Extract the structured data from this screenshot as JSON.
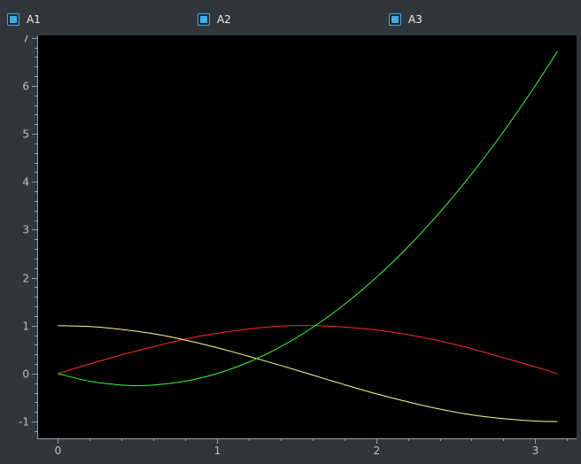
{
  "legend": {
    "items": [
      {
        "label": "A1",
        "checked": true
      },
      {
        "label": "A2",
        "checked": true
      },
      {
        "label": "A3",
        "checked": true
      }
    ]
  },
  "colors": {
    "accent": "#3daee9",
    "plot_background": "#000000",
    "axis": "#9ba0a5",
    "tick_label": "#bcc1c5"
  },
  "chart_data": {
    "type": "line",
    "title": "",
    "xlabel": "",
    "ylabel": "",
    "xlim": [
      -0.13,
      3.26
    ],
    "ylim": [
      -1.35,
      7.05
    ],
    "x_ticks": [
      0,
      1,
      2,
      3
    ],
    "y_ticks": [
      -1,
      0,
      1,
      2,
      3,
      4,
      5,
      6,
      7
    ],
    "grid": false,
    "series": [
      {
        "color": "#ff2a2a",
        "x": [
          0,
          0.2,
          0.4,
          0.6,
          0.8,
          1.0,
          1.2,
          1.4,
          1.6,
          1.8,
          2.0,
          2.2,
          2.4,
          2.6,
          2.8,
          3.0,
          3.14
        ],
        "y": [
          0,
          0.2,
          0.39,
          0.56,
          0.72,
          0.84,
          0.93,
          0.99,
          1.0,
          0.97,
          0.91,
          0.81,
          0.68,
          0.52,
          0.33,
          0.14,
          0.0
        ]
      },
      {
        "color": "#ffff88",
        "x": [
          0,
          0.2,
          0.4,
          0.6,
          0.8,
          1.0,
          1.2,
          1.4,
          1.6,
          1.8,
          2.0,
          2.2,
          2.4,
          2.6,
          2.8,
          3.0,
          3.14
        ],
        "y": [
          1.0,
          0.98,
          0.92,
          0.83,
          0.7,
          0.54,
          0.36,
          0.17,
          -0.03,
          -0.23,
          -0.42,
          -0.59,
          -0.74,
          -0.86,
          -0.94,
          -0.99,
          -1.0
        ]
      },
      {
        "color": "#33ff33",
        "x": [
          0,
          0.2,
          0.4,
          0.5,
          0.6,
          0.8,
          1.0,
          1.2,
          1.4,
          1.6,
          1.8,
          2.0,
          2.2,
          2.4,
          2.6,
          2.8,
          3.0,
          3.14
        ],
        "y": [
          0,
          -0.16,
          -0.24,
          -0.25,
          -0.24,
          -0.16,
          0.0,
          0.24,
          0.56,
          0.96,
          1.44,
          2.0,
          2.64,
          3.36,
          4.16,
          5.04,
          6.0,
          6.72
        ]
      }
    ]
  }
}
